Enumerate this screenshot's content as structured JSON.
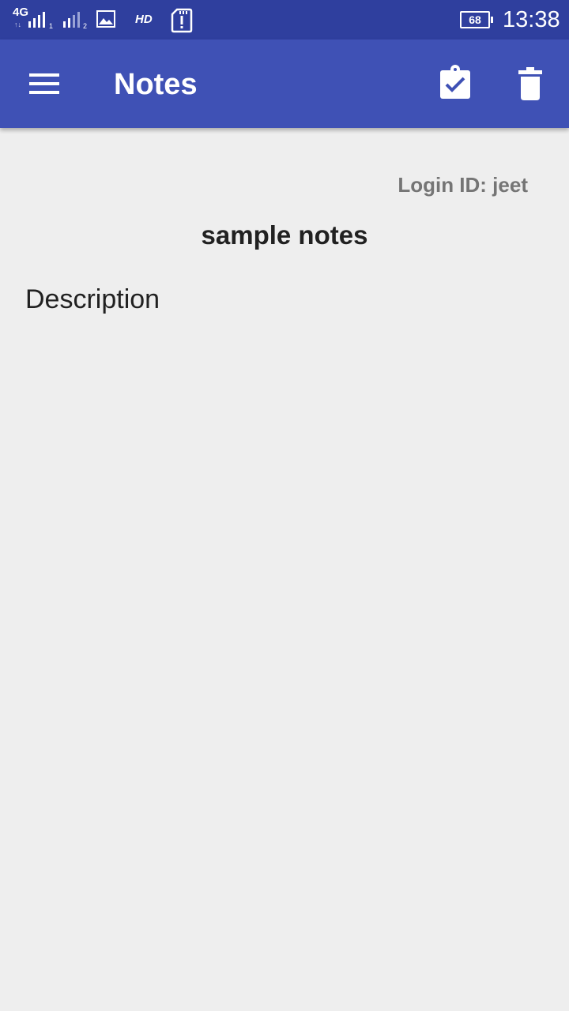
{
  "status_bar": {
    "network_type": "4G",
    "network_arrows": "↑↓",
    "sim1_number": "1",
    "sim2_number": "2",
    "hd_label": "HD",
    "battery_level": "68",
    "time": "13:38"
  },
  "app_bar": {
    "title": "Notes",
    "menu_icon": "hamburger-menu-icon",
    "save_icon": "clipboard-check-icon",
    "delete_icon": "trash-icon",
    "color": "#3f51b5"
  },
  "note": {
    "login_id": "Login ID: jeet",
    "title": "sample notes",
    "description": "Description"
  }
}
